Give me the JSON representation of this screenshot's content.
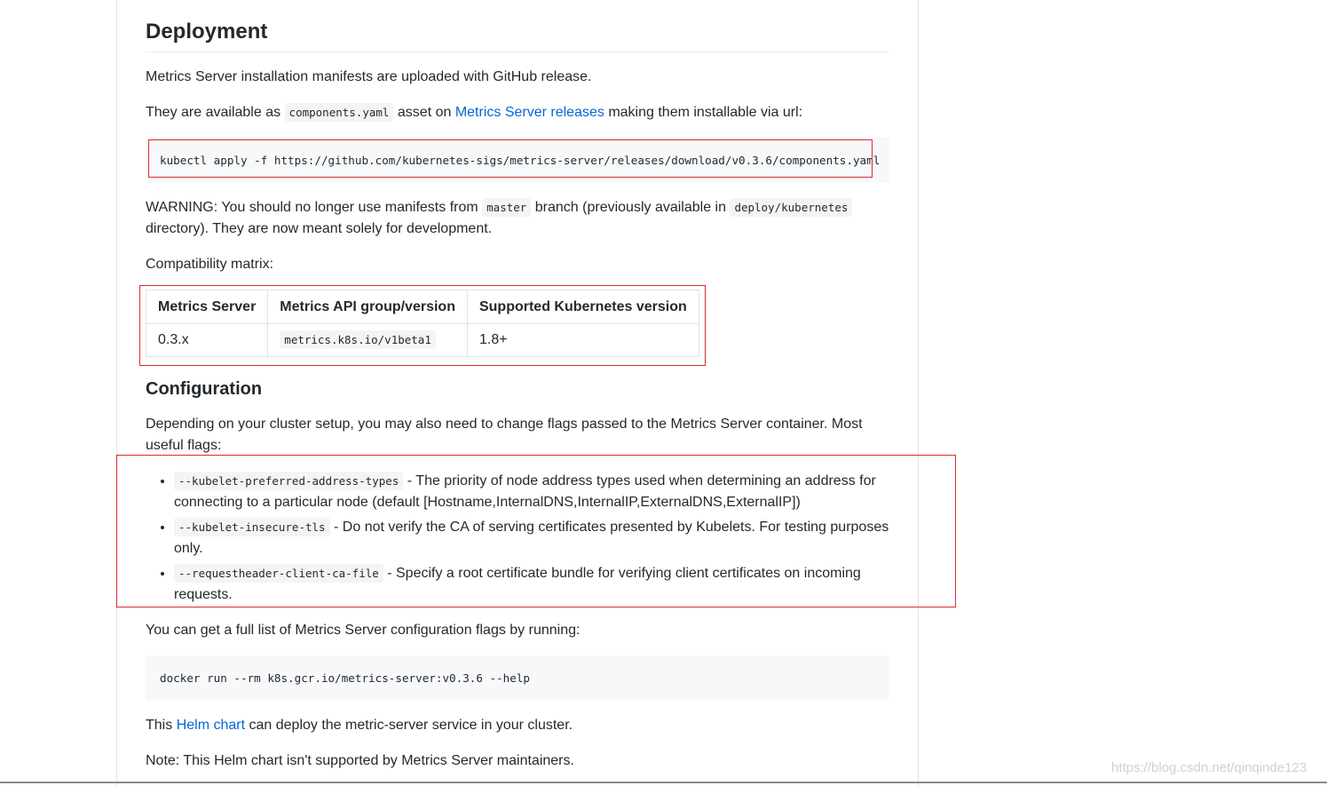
{
  "deployment": {
    "title": "Deployment",
    "intro": "Metrics Server installation manifests are uploaded with GitHub release.",
    "available_prefix": "They are available as",
    "available_code": "components.yaml",
    "available_mid": "asset on",
    "available_link": "Metrics Server releases",
    "available_suffix": "making them installable via url:",
    "install_command": "kubectl apply -f https://github.com/kubernetes-sigs/metrics-server/releases/download/v0.3.6/components.yaml",
    "warning_part1": "WARNING: You should no longer use manifests from",
    "warning_code1": "master",
    "warning_part2": "branch (previously available in",
    "warning_code2": "deploy/kubernetes",
    "warning_part3": "directory). They are now meant solely for development.",
    "matrix_caption": "Compatibility matrix:",
    "matrix": {
      "headers": [
        "Metrics Server",
        "Metrics API group/version",
        "Supported Kubernetes version"
      ],
      "row": {
        "server": "0.3.x",
        "api": "metrics.k8s.io/v1beta1",
        "k8s": "1.8+"
      }
    }
  },
  "configuration": {
    "title": "Configuration",
    "intro": "Depending on your cluster setup, you may also need to change flags passed to the Metrics Server container. Most useful flags:",
    "flags": [
      {
        "code": "--kubelet-preferred-address-types",
        "text": " - The priority of node address types used when determining an address for connecting to a particular node (default [Hostname,InternalDNS,InternalIP,ExternalDNS,ExternalIP])"
      },
      {
        "code": "--kubelet-insecure-tls",
        "text": " - Do not verify the CA of serving certificates presented by Kubelets. For testing purposes only."
      },
      {
        "code": "--requestheader-client-ca-file",
        "text": " - Specify a root certificate bundle for verifying client certificates on incoming requests."
      }
    ],
    "full_list": "You can get a full list of Metrics Server configuration flags by running:",
    "help_command": "docker run --rm k8s.gcr.io/metrics-server:v0.3.6 --help",
    "helm_prefix": "This",
    "helm_link": "Helm chart",
    "helm_suffix": "can deploy the metric-server service in your cluster.",
    "note": "Note: This Helm chart isn't supported by Metrics Server maintainers."
  },
  "watermark": "https://blog.csdn.net/qinqinde123",
  "colors": {
    "link": "#0366d6",
    "highlight_box": "#e0282e",
    "code_bg": "#f6f8fa"
  }
}
